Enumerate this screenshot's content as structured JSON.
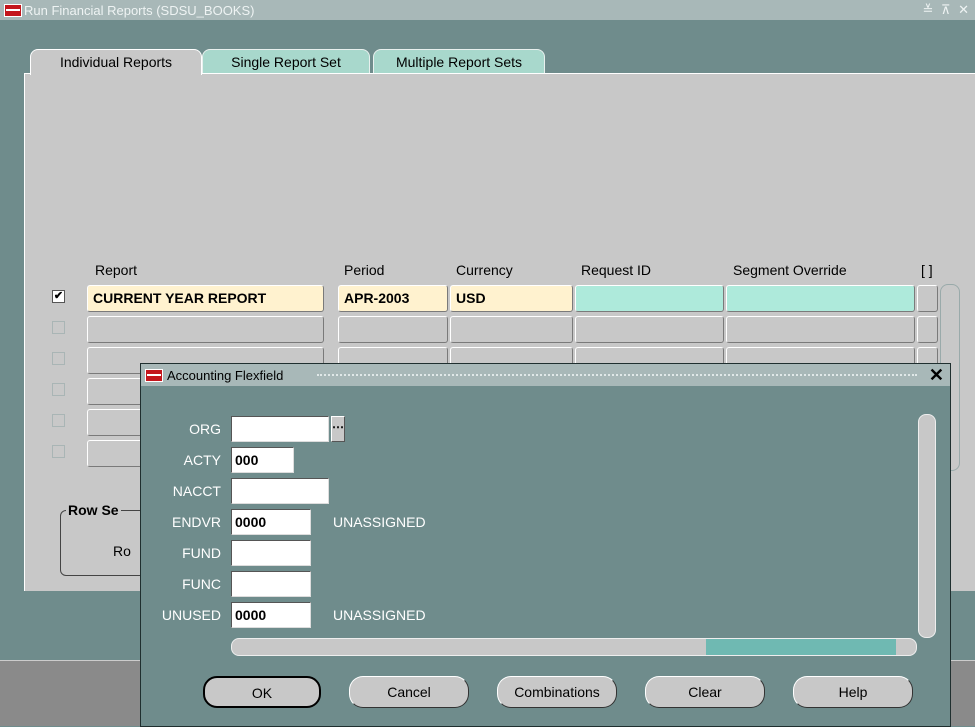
{
  "window": {
    "title": "Run Financial Reports (SDSU_BOOKS)",
    "controls": "≚ ⊼ ✕"
  },
  "tabs": [
    {
      "label": "Individual Reports",
      "active": true
    },
    {
      "label": "Single Report Set",
      "active": false
    },
    {
      "label": "Multiple Report Sets",
      "active": false
    }
  ],
  "table": {
    "columns": [
      "Report",
      "Period",
      "Currency",
      "Request ID",
      "Segment Override",
      "[ ]"
    ],
    "rows": [
      {
        "checked": true,
        "report": "CURRENT YEAR REPORT",
        "period": "APR-2003",
        "currency": "USD",
        "request_id": "",
        "segment_override": ""
      },
      {
        "checked": false,
        "report": "",
        "period": "",
        "currency": "",
        "request_id": "",
        "segment_override": ""
      },
      {
        "checked": false,
        "report": "",
        "period": "",
        "currency": "",
        "request_id": "",
        "segment_override": ""
      },
      {
        "checked": false,
        "report": "",
        "period": "",
        "currency": "",
        "request_id": "",
        "segment_override": ""
      },
      {
        "checked": false,
        "report": "",
        "period": "",
        "currency": "",
        "request_id": "",
        "segment_override": ""
      },
      {
        "checked": false,
        "report": "",
        "period": "",
        "currency": "",
        "request_id": "",
        "segment_override": ""
      }
    ]
  },
  "row_selection": {
    "title": "Row Se",
    "sub": "Ro"
  },
  "dialog": {
    "title": "Accounting Flexfield",
    "close": "✕",
    "segments": [
      {
        "label": "ORG",
        "value": "",
        "description": ""
      },
      {
        "label": "ACTY",
        "value": "000",
        "description": ""
      },
      {
        "label": "NACCT",
        "value": "",
        "description": ""
      },
      {
        "label": "ENDVR",
        "value": "0000",
        "description": "UNASSIGNED"
      },
      {
        "label": "FUND",
        "value": "",
        "description": ""
      },
      {
        "label": "FUNC",
        "value": "",
        "description": ""
      },
      {
        "label": "UNUSED",
        "value": "0000",
        "description": "UNASSIGNED"
      }
    ],
    "buttons": {
      "ok": "OK",
      "cancel": "Cancel",
      "combinations": "Combinations",
      "clear": "Clear",
      "help": "Help"
    }
  }
}
